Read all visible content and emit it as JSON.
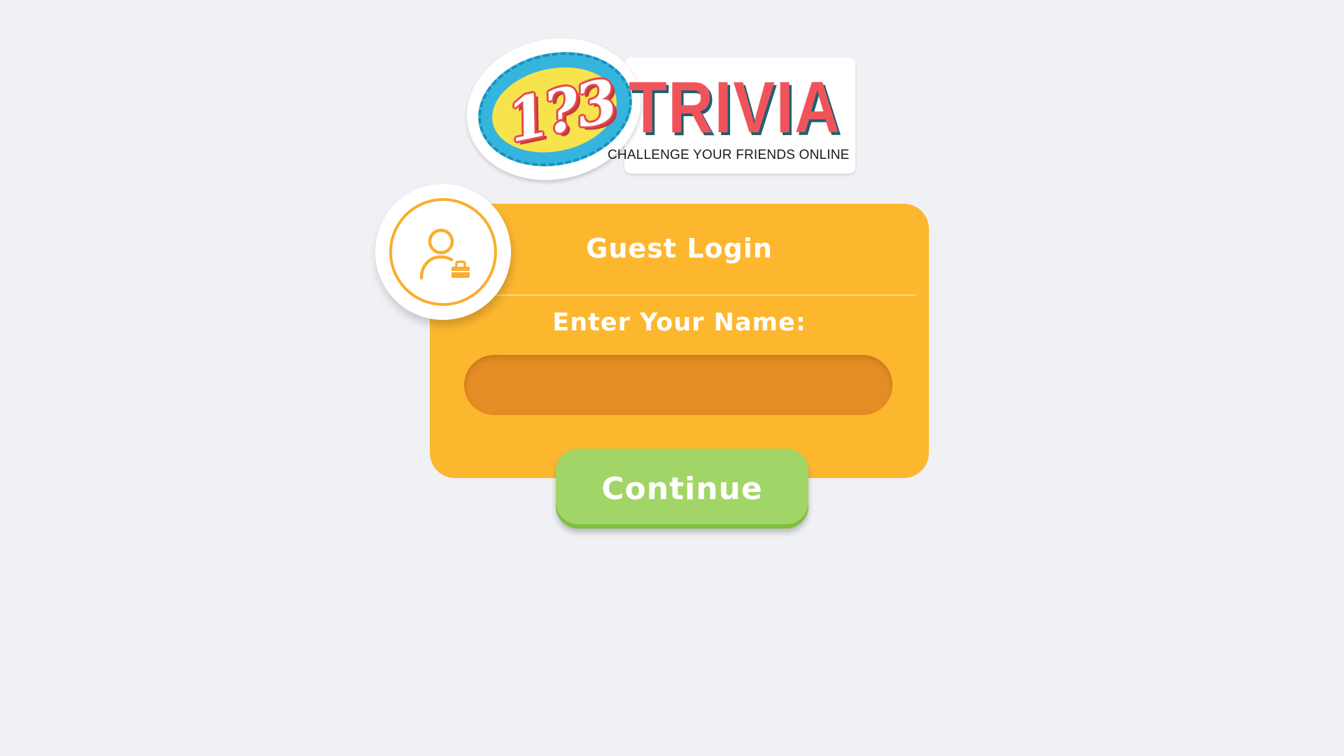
{
  "logo": {
    "numbers": "1?3",
    "word": "TRIVIA",
    "tagline": "CHALLENGE YOUR FRIENDS ONLINE"
  },
  "login": {
    "title": "Guest Login",
    "name_label": "Enter Your Name:",
    "name_value": "",
    "continue_label": "Continue"
  },
  "icons": {
    "avatar": "guest-user-icon"
  },
  "colors": {
    "background": "#f0f1f5",
    "card": "#fdb72f",
    "input": "#e58d25",
    "button": "#a2d567",
    "logo_red": "#f0545a",
    "logo_blue": "#35b5dd",
    "logo_yellow": "#f7e34b"
  }
}
